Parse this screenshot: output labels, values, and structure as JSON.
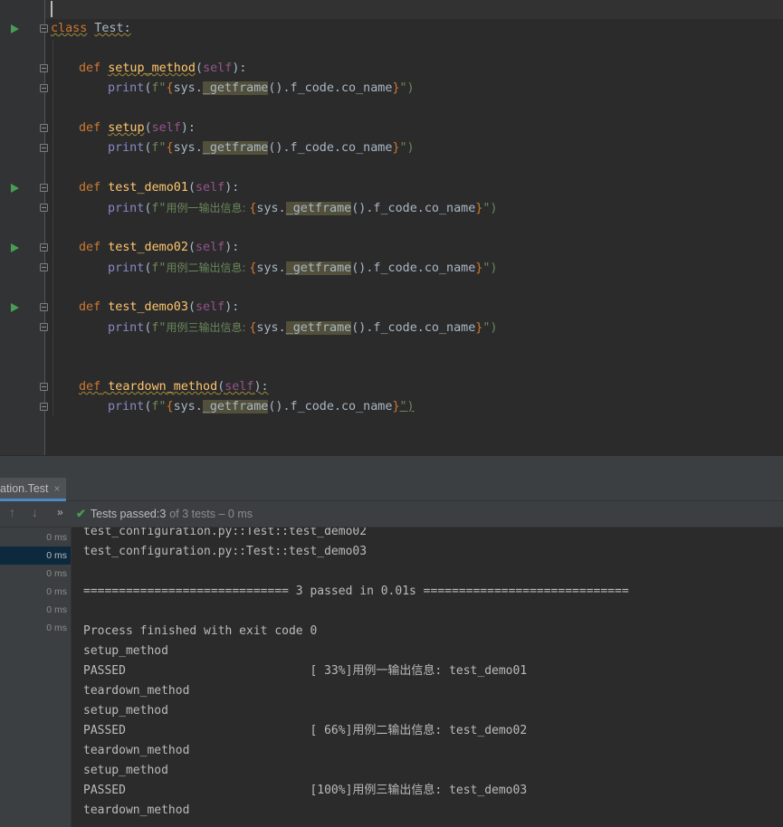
{
  "editor": {
    "lines": {
      "class_kw": "class",
      "class_name": "Test:",
      "def": "def",
      "self": "self",
      "print": "print",
      "m1": "setup_method",
      "m2": "setup",
      "m3": "test_demo01",
      "m4": "test_demo02",
      "m5": "test_demo03",
      "m6": "teardown_method",
      "open_paren": "(",
      "close_colon": "):",
      "fprefix": "f\"",
      "sys": "sys.",
      "getframe": "_getframe",
      "tail": "().f_code.co_name",
      "lbrace": "{",
      "rbrace": "}",
      "quote_close": "\")",
      "label1": "用例一输出信息: ",
      "label2": "用例二输出信息: ",
      "label3": "用例三输出信息: "
    }
  },
  "run_panel": {
    "tab_label": "ation.Test",
    "tab_close": "×",
    "status_prefix": "Tests passed: ",
    "passed_count": "3",
    "status_rest": "of 3 tests – 0 ms",
    "tree_times": [
      "0 ms",
      "0 ms",
      "0 ms",
      "0 ms",
      "0 ms",
      "0 ms"
    ]
  },
  "console": {
    "lines": [
      "test_configuration.py::Test::test_demo02",
      "test_configuration.py::Test::test_demo03",
      "",
      "============================= 3 passed in 0.01s =============================",
      "",
      "Process finished with exit code 0",
      "setup_method",
      "PASSED                          [ 33%]用例一输出信息: test_demo01",
      "teardown_method",
      "setup_method",
      "PASSED                          [ 66%]用例二输出信息: test_demo02",
      "teardown_method",
      "setup_method",
      "PASSED                          [100%]用例三输出信息: test_demo03",
      "teardown_method"
    ]
  },
  "colors": {
    "keyword": "#cc7832",
    "function": "#ffc66d",
    "self": "#94558d",
    "string": "#6a8759",
    "run_green": "#499c54",
    "accent": "#4a88c7"
  }
}
